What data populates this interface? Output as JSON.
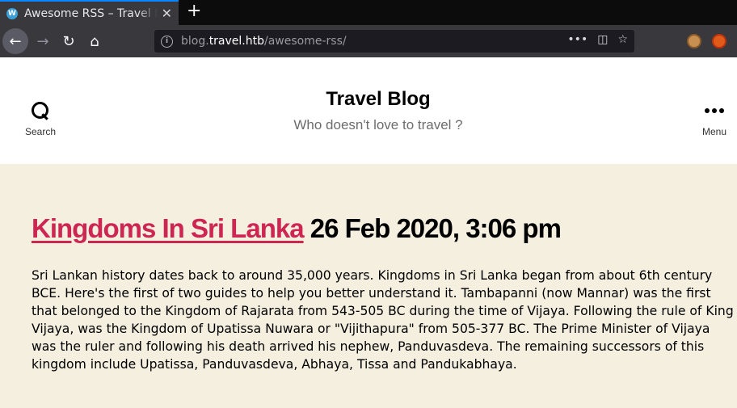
{
  "browser": {
    "tab": {
      "title": "Awesome RSS – Travel Blog",
      "favicon": "wordpress-icon"
    },
    "new_tab_label": "+",
    "close_label": "✕",
    "url": {
      "domain_prefix": "blog.",
      "domain": "travel.htb",
      "path": "/awesome-rss/"
    },
    "icons": [
      "back-arrow-icon",
      "forward-arrow-icon",
      "reload-icon",
      "home-icon",
      "info-icon",
      "more-dots-icon",
      "pocket-icon",
      "bookmark-star-icon",
      "cookie-extension-icon",
      "fox-extension-icon"
    ]
  },
  "header": {
    "site_title": "Travel Blog",
    "site_description": "Who doesn't love to travel ?",
    "search_label": "Search",
    "menu_label": "Menu"
  },
  "article": {
    "title": "Kingdoms In Sri Lanka",
    "date": "26 Feb 2020, 3:06 pm",
    "body": "Sri Lankan history dates back to around 35,000 years. Kingdoms in Sri Lanka began from about 6th century BCE. Here's the first of two guides to help you better understand it. Tambapanni (now Mannar) was the first that belonged to the Kingdom of Rajarata from 543-505 BC during the time of Vijaya. Following the rule of King Vijaya, was the Kingdom of Upatissa Nuwara or \"Vijithapura\" from 505-377 BC. The Prime Minister of Vijaya was the ruler and following his death arrived his nephew, Panduvasdeva. The remaining successors of this kingdom include Upatissa, Panduvasdeva, Abhaya, Tissa and Pandukabhaya."
  },
  "colors": {
    "accent": "#cd2653",
    "background": "#f5efe0",
    "header_bg": "#ffffff"
  }
}
